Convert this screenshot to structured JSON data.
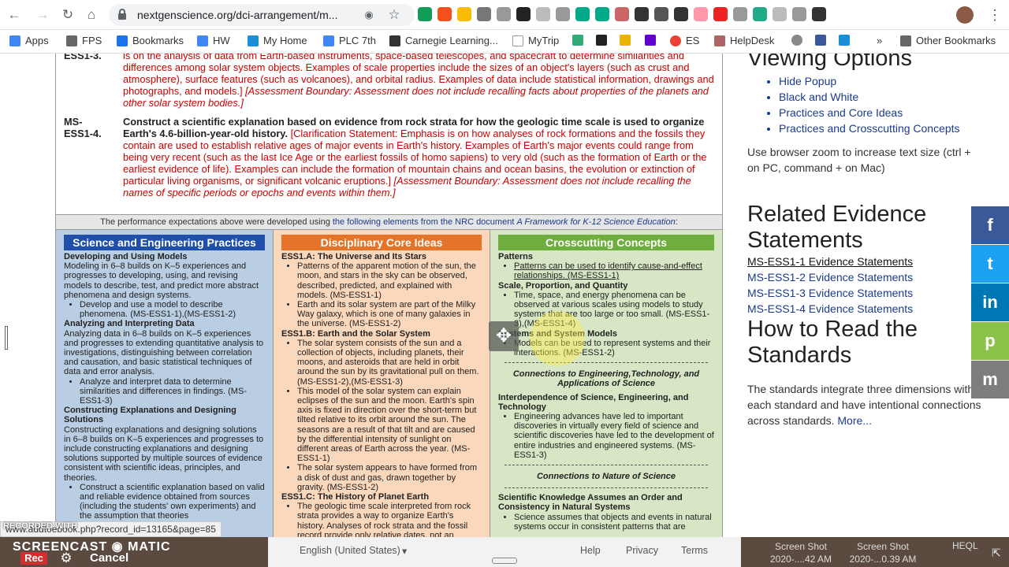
{
  "browser": {
    "url": "nextgenscience.org/dci-arrangement/m...",
    "bookmarks": [
      "Apps",
      "FPS",
      "Bookmarks",
      "HW",
      "My Home",
      "PLC 7th",
      "Carnegie Learning...",
      "MyTrip",
      "ES",
      "HelpDesk"
    ],
    "more": "»",
    "other_bookmarks": "Other Bookmarks",
    "ext_colors": [
      "#0f9d58",
      "#f4511e",
      "#fbbc04",
      "#777",
      "#999",
      "#222",
      "#bbb",
      "#999",
      "#0a8",
      "#0a8",
      "#c66",
      "#333",
      "#555",
      "#333",
      "#f9a",
      "#e22",
      "#999",
      "#2a8",
      "#bbb",
      "#999",
      "#333"
    ]
  },
  "pe": {
    "ess13_tail": "is on the analysis of data from Earth-based instruments, space-based telescopes, and spacecraft to determine similarities and differences among solar system objects. Examples of scale properties include the sizes of an object's layers (such as crust and atmosphere), surface features (such as volcanoes), and orbital radius. Examples of data include statistical information, drawings and photographs, and models.]",
    "ess13_boundary": "[Assessment Boundary: Assessment does not include recalling facts about properties of the planets and other solar system bodies.]",
    "ess13_code": "ESS1-3.",
    "ess14_code": "MS-ESS1-4.",
    "ess14_bold": "Construct a scientific explanation based on evidence from rock strata for how the geologic time scale is used to organize Earth's 4.6-billion-year-old history.",
    "ess14_clar": "[Clarification Statement: Emphasis is on how analyses of rock formations and the fossils they contain are used to establish relative ages of major events in Earth's history. Examples of Earth's major events could range from being very recent (such as the last Ice Age or the earliest fossils of homo sapiens) to very old (such as the formation of Earth or the earliest evidence of life). Examples can include the formation of mountain chains and ocean basins, the evolution or extinction of particular living organisms, or significant volcanic eruptions.]",
    "ess14_boundary": "[Assessment Boundary: Assessment does not include recalling the names of specific periods or epochs and events within them.]"
  },
  "footnote": {
    "pre": "The performance expectations above were developed using ",
    "link": "the following elements from the NRC document ",
    "link_italic": "A Framework for K-12 Science Education",
    "post": ":"
  },
  "sep": {
    "title": "Science and Engineering Practices",
    "h1": "Developing and Using Models",
    "p1": "Modeling in 6–8 builds on K–5 experiences and progresses to developing, using, and revising models to describe, test, and predict more abstract phenomena and design systems.",
    "li1": "Develop and use a model to describe phenomena. (MS-ESS1-1),(MS-ESS1-2)",
    "h2": "Analyzing and Interpreting Data",
    "p2": "Analyzing data in 6–8 builds on K–5 experiences and progresses to extending quantitative analysis to investigations, distinguishing between correlation and causation, and basic statistical techniques of data and error analysis.",
    "li2": "Analyze and interpret data to determine similarities and differences in findings. (MS-ESS1-3)",
    "h3": "Constructing Explanations and Designing Solutions",
    "p3": "Constructing explanations and designing solutions in 6–8 builds on K–5 experiences and progresses to include constructing explanations and designing solutions supported by multiple sources of evidence consistent with scientific ideas, principles, and theories.",
    "li3": "Construct a scientific explanation based on valid and reliable evidence obtained from sources (including the students' own experiments) and the assumption that theories"
  },
  "dci": {
    "title": "Disciplinary Core Ideas",
    "h1": "ESS1.A: The Universe and Its Stars",
    "a1": "Patterns of the apparent motion of the sun, the moon, and stars in the sky can be observed, described, predicted, and explained with models. (MS-ESS1-1)",
    "a2": "Earth and its solar system are part of the Milky Way galaxy, which is one of many galaxies in the universe. (MS-ESS1-2)",
    "h2": "ESS1.B: Earth and the Solar System",
    "b1": "The solar system consists of the sun and a collection of objects, including planets, their moons, and asteroids that are held in orbit around the sun by its gravitational pull on them. (MS-ESS1-2),(MS-ESS1-3)",
    "b2": "This model of the solar system can explain eclipses of the sun and the moon. Earth's spin axis is fixed in direction over the short-term but tilted relative to its orbit around the sun. The seasons are a result of that tilt and are caused by the differential intensity of sunlight on different areas of Earth across the year. (MS-ESS1-1)",
    "b3": "The solar system appears to have formed from a disk of dust and gas, drawn together by gravity. (MS-ESS1-2)",
    "h3": "ESS1.C: The History of Planet Earth",
    "c1": "The geologic time scale interpreted from rock strata provides a way to organize Earth's history. Analyses of rock strata and the fossil record provide only relative dates, not an"
  },
  "ccc": {
    "title": "Crosscutting Concepts",
    "h1": "Patterns",
    "p1": "Patterns can be used to identify cause-and-effect relationships. (MS-ESS1-1)",
    "h2": "Scale, Proportion, and Quantity",
    "p2": "Time, space, and energy phenomena can be observed at various scales using models to study systems that are too large or too small. (MS-ESS1-3),(MS-ESS1-4)",
    "h3": "Systems and System Models",
    "p3": "Models can be used to represent systems and their interactions. (MS-ESS1-2)",
    "conn1": "Connections to Engineering,Technology, and Applications of Science",
    "h4": "Interdependence of Science, Engineering, and Technology",
    "p4": "Engineering advances have led to important discoveries in virtually every field of science and scientific discoveries have led to the development of entire industries and engineered systems. (MS-ESS1-3)",
    "conn2": "Connections to Nature of Science",
    "h5": "Scientific Knowledge Assumes an Order and Consistency in Natural Systems",
    "p5": "Science assumes that objects and events in natural systems occur in consistent patterns that are"
  },
  "sidebar": {
    "viewing_title": "Viewing Options",
    "viewing": [
      "Hide Popup",
      "Black and White",
      "Practices and Core Ideas",
      "Practices and Crosscutting Concepts"
    ],
    "zoom_text": "Use browser zoom to increase text size (ctrl + on PC, command + on Mac)",
    "related_title": "Related Evidence Statements",
    "related": [
      "MS-ESS1-1 Evidence Statements",
      "MS-ESS1-2 Evidence Statements",
      "MS-ESS1-3 Evidence Statements",
      "MS-ESS1-4 Evidence Statements"
    ],
    "howto_title": "How to Read the Standards",
    "howto_text": "The standards integrate three dimensions within each standard and have intentional connections across standards.",
    "more": "More..."
  },
  "share": {
    "facebook": "f",
    "twitter": "t",
    "linkedin": "in",
    "print": "p",
    "email": "m"
  },
  "status_url": "www.addtoebook.php?record_id=13165&page=85",
  "recorder": {
    "recorded_with": "RECORDED WITH",
    "logo": "SCREENCAST ◉ MATIC",
    "rec": "Rec",
    "cancel": "Cancel"
  },
  "footer": {
    "language": "English (United States)",
    "help": "Help",
    "privacy": "Privacy",
    "terms": "Terms"
  },
  "desktop": {
    "shot1_title": "Screen Shot",
    "shot1_date": "2020-....42 AM",
    "shot2_title": "Screen Shot",
    "shot2_date": "2020-...0.39 AM",
    "heql": "HEQL"
  }
}
